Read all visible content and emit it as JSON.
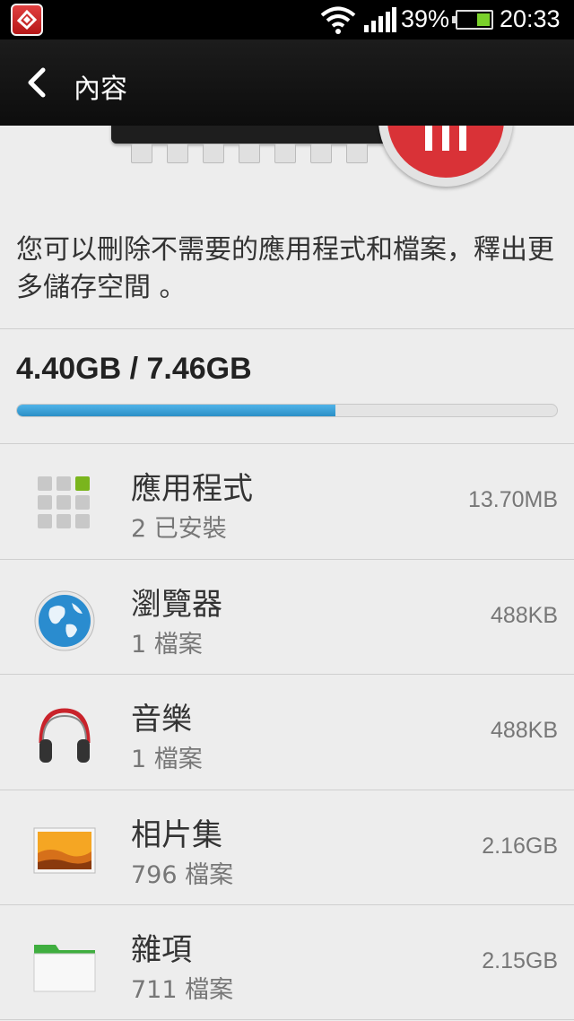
{
  "status_bar": {
    "battery_percent": "39%",
    "time": "20:33",
    "battery_level": 0.39
  },
  "action_bar": {
    "title": "內容"
  },
  "description": "您可以刪除不需要的應用程式和檔案，釋出更多儲存空間 。",
  "storage": {
    "usage_text": "4.40GB / 7.46GB",
    "used_fraction": 0.59
  },
  "items": [
    {
      "title": "應用程式",
      "subtitle": "2 已安裝",
      "size": "13.70MB",
      "icon": "apps-grid-icon"
    },
    {
      "title": "瀏覽器",
      "subtitle": "1 檔案",
      "size": "488KB",
      "icon": "globe-icon"
    },
    {
      "title": "音樂",
      "subtitle": "1 檔案",
      "size": "488KB",
      "icon": "headphones-icon"
    },
    {
      "title": "相片集",
      "subtitle": "796 檔案",
      "size": "2.16GB",
      "icon": "gallery-icon"
    },
    {
      "title": "雜項",
      "subtitle": "711 檔案",
      "size": "2.15GB",
      "icon": "folder-icon"
    }
  ],
  "colors": {
    "progress_fill": "#2b8fc6",
    "accent_red": "#d93237",
    "apps_green": "#7ab51d"
  }
}
